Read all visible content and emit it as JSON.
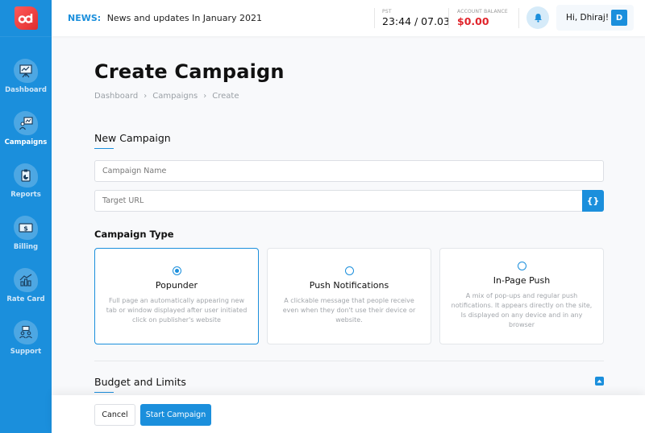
{
  "app": {
    "logo_icon": "ad-logo-icon"
  },
  "sidebar": {
    "items": [
      {
        "label": "Dashboard",
        "icon": "presentation-chart-icon",
        "active": false
      },
      {
        "label": "Campaigns",
        "icon": "presenter-chart-icon",
        "active": true
      },
      {
        "label": "Reports",
        "icon": "clipboard-pie-icon",
        "active": false
      },
      {
        "label": "Billing",
        "icon": "dollar-bill-icon",
        "active": false
      },
      {
        "label": "Rate Card",
        "icon": "bar-chart-trend-icon",
        "active": false
      },
      {
        "label": "Support",
        "icon": "team-support-icon",
        "active": false
      }
    ]
  },
  "header": {
    "news_label": "NEWS:",
    "news_text": "News and updates In January 2021",
    "time_label": "PST",
    "time_value": "23:44 / 07.03",
    "balance_label": "ACCOUNT BALANCE",
    "balance_value": "$0.00",
    "notification_icon": "bell-icon",
    "greeting": "Hi, Dhiraj!",
    "avatar_initial": "D"
  },
  "page": {
    "title": "Create Campaign",
    "breadcrumb": [
      "Dashboard",
      "Campaigns",
      "Create"
    ],
    "breadcrumb_separator": "›"
  },
  "new_campaign": {
    "section_title": "New Campaign",
    "campaign_name_placeholder": "Campaign Name",
    "campaign_name_value": "",
    "target_url_placeholder": "Target URL",
    "target_url_value": "",
    "macro_button_label": "{}"
  },
  "campaign_type": {
    "title": "Campaign Type",
    "selected": "Popunder",
    "options": [
      {
        "label": "Popunder",
        "description": "Full page an automatically appearing new tab or window displayed after user initiated click on publisher's website",
        "selected": true
      },
      {
        "label": "Push Notifications",
        "description": "A clickable message that people receive even when they don't use their device or website.",
        "selected": false
      },
      {
        "label": "In-Page Push",
        "description": "A mix of pop-ups and regular push notifications. It appears directly on the site, Is displayed on any device and in any browser",
        "selected": false
      }
    ]
  },
  "budget": {
    "section_title": "Budget and Limits",
    "collapse_icon": "caret-up-icon"
  },
  "footer": {
    "cancel_label": "Cancel",
    "start_label": "Start Campaign"
  },
  "colors": {
    "primary": "#1b8fdc",
    "danger": "#e0242b",
    "logo": "#ef3b3b"
  }
}
